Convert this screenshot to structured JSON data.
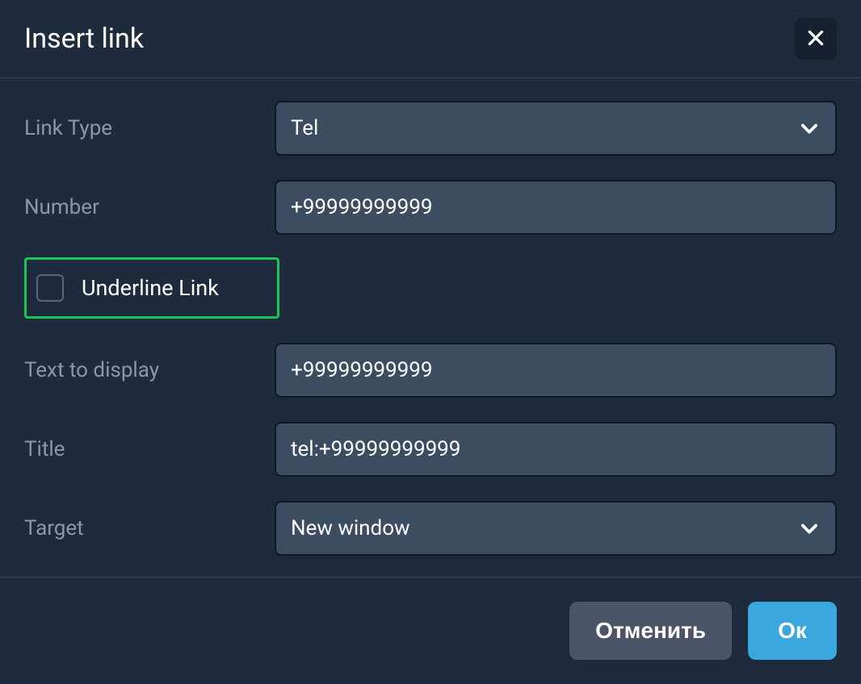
{
  "dialog": {
    "title": "Insert link",
    "labels": {
      "link_type": "Link Type",
      "number": "Number",
      "underline": "Underline Link",
      "text_to_display": "Text to display",
      "title_field": "Title",
      "target": "Target"
    },
    "values": {
      "link_type": "Tel",
      "number": "+99999999999",
      "underline_checked": false,
      "text_to_display": "+99999999999",
      "title_field": "tel:+99999999999",
      "target": "New window"
    },
    "buttons": {
      "cancel": "Отменить",
      "ok": "Ок"
    },
    "highlight": {
      "color": "#1bc554",
      "element": "underline-link-row"
    }
  }
}
